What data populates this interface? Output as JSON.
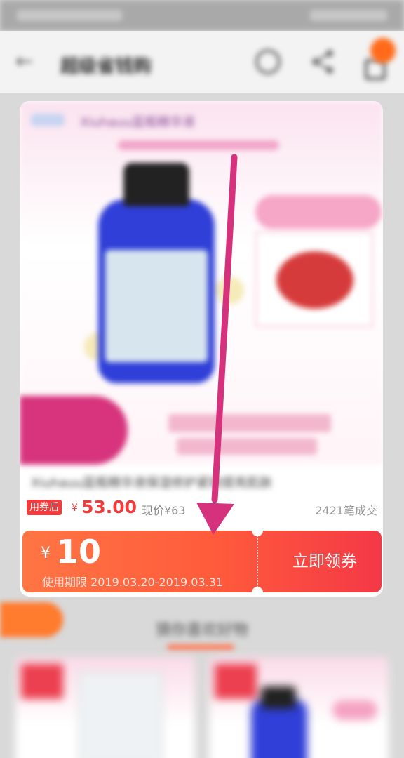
{
  "header": {
    "title": "超级省钱购",
    "back_icon": "back-arrow-icon",
    "refresh_icon": "refresh-icon",
    "share_icon": "share-icon",
    "cart_icon": "cart-icon"
  },
  "product": {
    "banner_title": "Xiuhauu蓝瓶精华液",
    "name": "Xiuhauu蓝瓶精华液保湿修护紧致提亮肌肤",
    "coupon_tag": "用券后",
    "price_currency": "¥",
    "price": "53.00",
    "original_price": "现价¥63",
    "sales": "2421笔成交"
  },
  "coupon": {
    "currency": "¥",
    "amount": "10",
    "validity": "使用期限 2019.03.20-2019.03.31",
    "claim_label": "立即领券"
  },
  "recommend": {
    "section_title": "猜你喜欢好物"
  },
  "colors": {
    "accent_red": "#f23b3b",
    "coupon_gradient_start": "#ff7543",
    "coupon_gradient_end": "#f43847",
    "annotation_arrow": "#d6317c"
  }
}
